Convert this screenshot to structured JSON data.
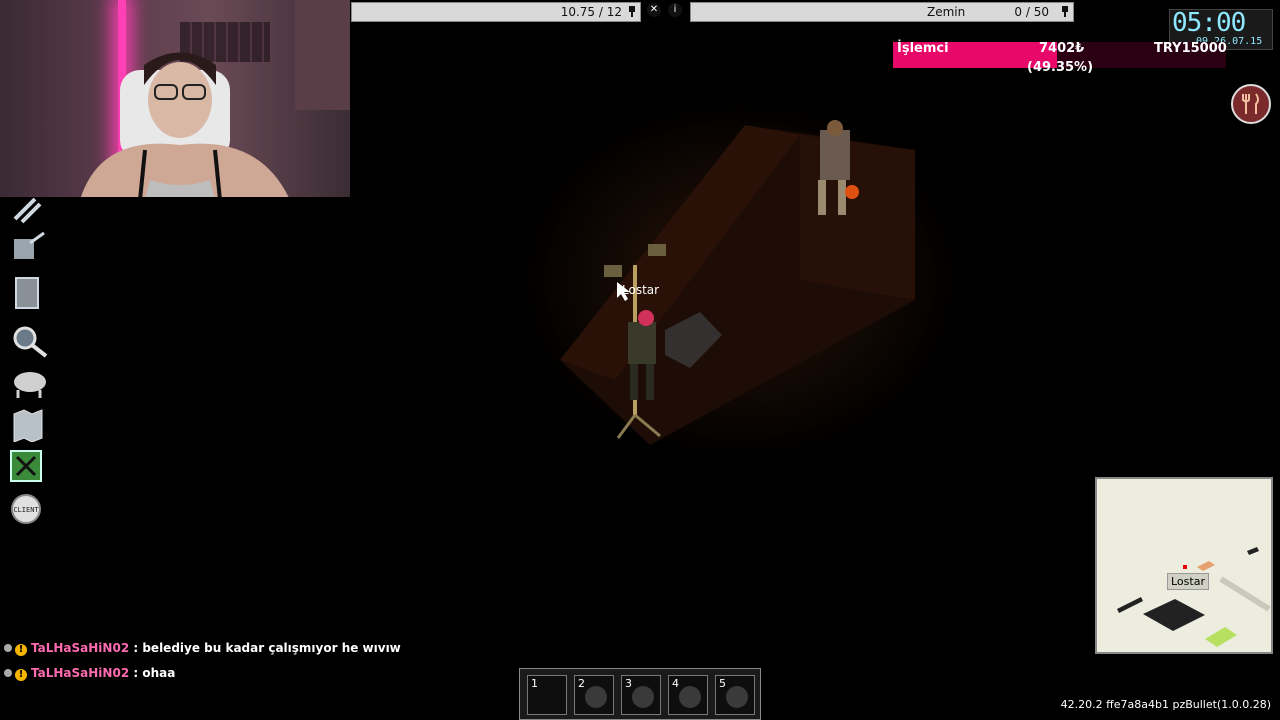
{
  "hud": {
    "weight": "10.75 / 12",
    "floor_label": "Zemin",
    "floor_value": "0 / 50"
  },
  "clock": {
    "time": "05:00",
    "date": "09.26.07.15"
  },
  "cpu": {
    "label": "İşlemci",
    "value": "7402₺",
    "goal": "TRY15000",
    "percent_text": "(49.35%)",
    "progress": 0.4935,
    "color": "#e8086a"
  },
  "icons": {
    "food": "fork-knife-icon",
    "tools": [
      "crafting-icon",
      "cooking-icon",
      "building-icon",
      "search-icon",
      "animals-icon",
      "map-icon",
      "admin-tools-icon",
      "client-icon"
    ]
  },
  "tools": {
    "client_label": "CLIENT"
  },
  "player": {
    "name": "Lostar"
  },
  "chat": [
    {
      "name": "TaLHaSaHiN02",
      "message": ": belediye bu kadar çalışmıyor he wıvıw"
    },
    {
      "name": "TaLHaSaHiN02",
      "message": ": ohaa"
    }
  ],
  "hotbar": {
    "slots": [
      "1",
      "2",
      "3",
      "4",
      "5"
    ]
  },
  "minimap": {
    "player_tag": "Lostar"
  },
  "version": "42.20.2 ffe7a8a4b1 pzBullet(1.0.0.28)"
}
